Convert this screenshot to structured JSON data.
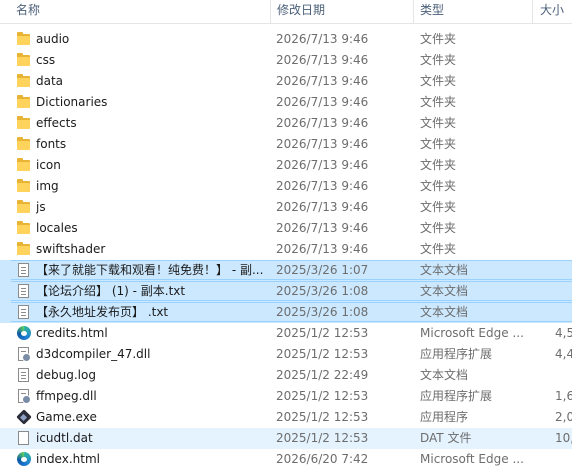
{
  "header": {
    "name": "名称",
    "date": "修改日期",
    "type": "类型",
    "size": "大小"
  },
  "files": [
    {
      "icon": "folder-icon",
      "name": "audio",
      "date": "2026/7/13 9:46",
      "type": "文件夹",
      "size": "",
      "state": ""
    },
    {
      "icon": "folder-icon",
      "name": "css",
      "date": "2026/7/13 9:46",
      "type": "文件夹",
      "size": "",
      "state": ""
    },
    {
      "icon": "folder-icon",
      "name": "data",
      "date": "2026/7/13 9:46",
      "type": "文件夹",
      "size": "",
      "state": ""
    },
    {
      "icon": "folder-icon",
      "name": "Dictionaries",
      "date": "2026/7/13 9:46",
      "type": "文件夹",
      "size": "",
      "state": ""
    },
    {
      "icon": "folder-icon",
      "name": "effects",
      "date": "2026/7/13 9:46",
      "type": "文件夹",
      "size": "",
      "state": ""
    },
    {
      "icon": "folder-icon",
      "name": "fonts",
      "date": "2026/7/13 9:46",
      "type": "文件夹",
      "size": "",
      "state": ""
    },
    {
      "icon": "folder-icon",
      "name": "icon",
      "date": "2026/7/13 9:46",
      "type": "文件夹",
      "size": "",
      "state": ""
    },
    {
      "icon": "folder-icon",
      "name": "img",
      "date": "2026/7/13 9:46",
      "type": "文件夹",
      "size": "",
      "state": ""
    },
    {
      "icon": "folder-icon",
      "name": "js",
      "date": "2026/7/13 9:46",
      "type": "文件夹",
      "size": "",
      "state": ""
    },
    {
      "icon": "folder-icon",
      "name": "locales",
      "date": "2026/7/13 9:46",
      "type": "文件夹",
      "size": "",
      "state": ""
    },
    {
      "icon": "folder-icon",
      "name": "swiftshader",
      "date": "2026/7/13 9:46",
      "type": "文件夹",
      "size": "",
      "state": ""
    },
    {
      "icon": "text-document-icon",
      "name": "【来了就能下载和观看！纯免费！】 - 副...",
      "date": "2025/3/26 1:07",
      "type": "文本文档",
      "size": "",
      "state": "selected"
    },
    {
      "icon": "text-document-icon",
      "name": "【论坛介绍】 (1) - 副本.txt",
      "date": "2025/3/26 1:08",
      "type": "文本文档",
      "size": "",
      "state": "selected"
    },
    {
      "icon": "text-document-icon",
      "name": "【永久地址发布页】 .txt",
      "date": "2025/3/26 1:08",
      "type": "文本文档",
      "size": "",
      "state": "selected"
    },
    {
      "icon": "edge-icon",
      "name": "credits.html",
      "date": "2025/1/2 12:53",
      "type": "Microsoft Edge ...",
      "size": "4,5",
      "state": ""
    },
    {
      "icon": "dll-icon",
      "name": "d3dcompiler_47.dll",
      "date": "2025/1/2 12:53",
      "type": "应用程序扩展",
      "size": "4,4",
      "state": ""
    },
    {
      "icon": "text-document-icon",
      "name": "debug.log",
      "date": "2025/1/2 22:49",
      "type": "文本文档",
      "size": "",
      "state": ""
    },
    {
      "icon": "dll-icon",
      "name": "ffmpeg.dll",
      "date": "2025/1/2 12:53",
      "type": "应用程序扩展",
      "size": "1,6",
      "state": ""
    },
    {
      "icon": "game-exe-icon",
      "name": "Game.exe",
      "date": "2025/1/2 12:53",
      "type": "应用程序",
      "size": "2,0",
      "state": ""
    },
    {
      "icon": "document-icon",
      "name": "icudtl.dat",
      "date": "2025/1/2 12:53",
      "type": "DAT 文件",
      "size": "10,2",
      "state": "hovered"
    },
    {
      "icon": "edge-icon",
      "name": "index.html",
      "date": "2026/6/20 7:42",
      "type": "Microsoft Edge ...",
      "size": "",
      "state": ""
    }
  ]
}
